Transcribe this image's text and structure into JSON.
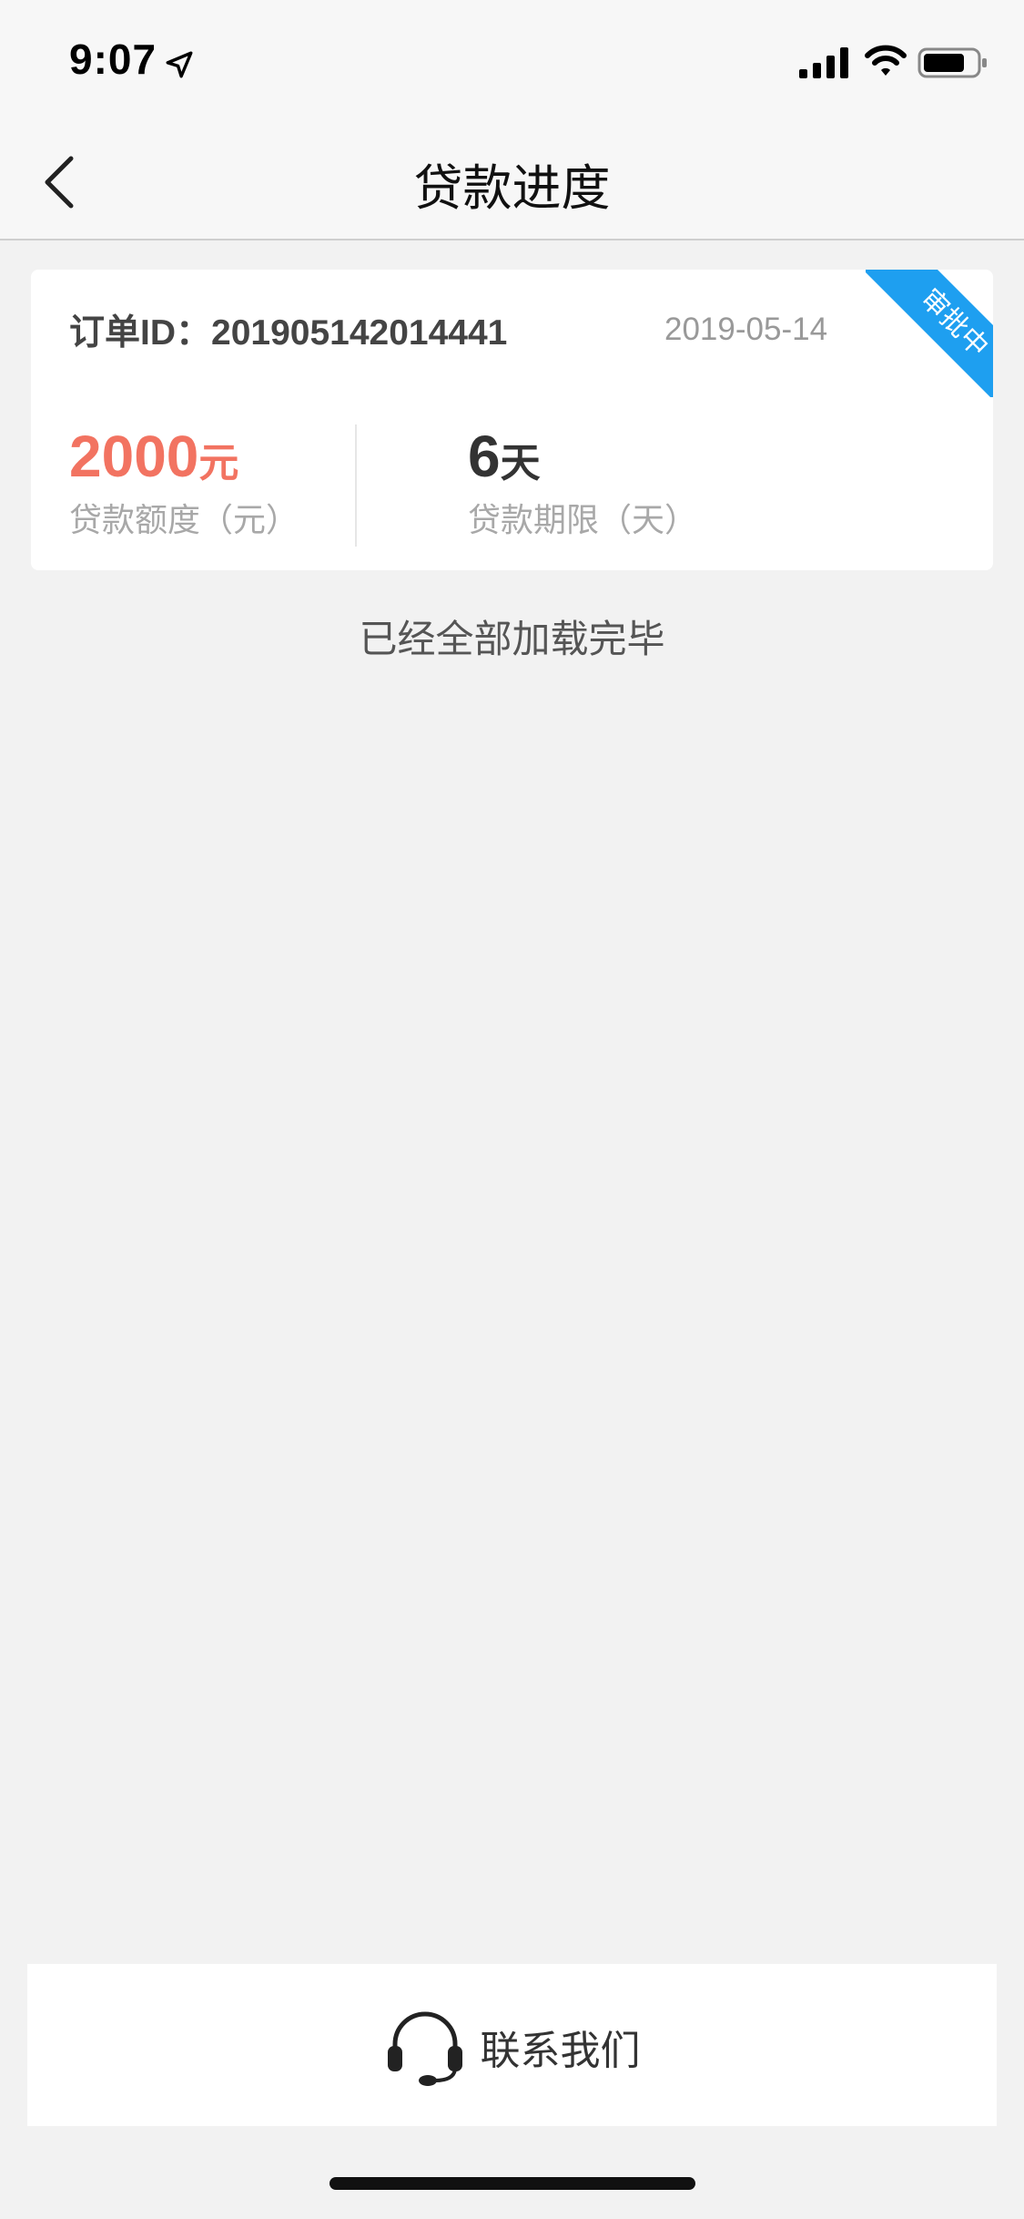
{
  "status_bar": {
    "time": "9:07"
  },
  "nav": {
    "title": "贷款进度"
  },
  "order": {
    "id_label": "订单ID：201905142014441",
    "date": "2019-05-14",
    "status_ribbon": "审批中",
    "amount_value": "2000",
    "amount_unit": "元",
    "amount_label": "贷款额度（元）",
    "term_value": "6",
    "term_unit": "天",
    "term_label": "贷款期限（天）"
  },
  "list_footer": "已经全部加载完毕",
  "contact": {
    "label": "联系我们"
  },
  "colors": {
    "accent_amount": "#f27361",
    "ribbon": "#1e9ff0",
    "background": "#f2f2f2"
  },
  "icons": [
    "location-arrow-icon",
    "signal-icon",
    "wifi-icon",
    "battery-icon",
    "chevron-left-icon",
    "headset-icon"
  ]
}
